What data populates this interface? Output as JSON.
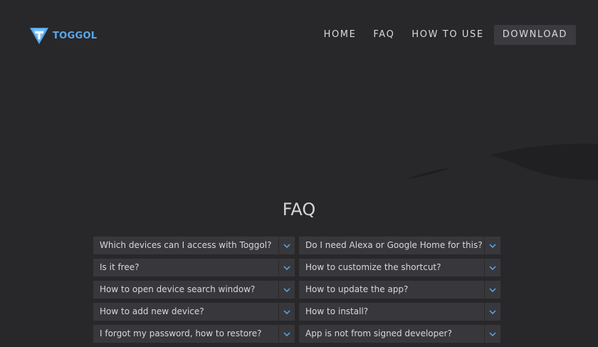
{
  "brand": {
    "name": "TOGGOL",
    "logo_color": "#5aa8ea"
  },
  "nav": {
    "items": [
      {
        "label": "HOME"
      },
      {
        "label": "FAQ"
      },
      {
        "label": "HOW TO USE"
      },
      {
        "label": "DOWNLOAD"
      }
    ]
  },
  "faq": {
    "title": "FAQ",
    "left": [
      {
        "question": "Which devices can I access with Toggol?",
        "icon": "chevron-down-icon"
      },
      {
        "question": "Is it free?",
        "icon": "chevron-down-icon"
      },
      {
        "question": "How to open device search window?",
        "icon": "chevron-down-icon"
      },
      {
        "question": "How to add new device?",
        "icon": "chevron-down-icon"
      },
      {
        "question": "I forgot my password, how to restore?",
        "icon": "chevron-down-icon"
      }
    ],
    "right": [
      {
        "question": "Do I need Alexa or Google Home for this?",
        "icon": "chevron-down-icon"
      },
      {
        "question": "How to customize the shortcut?",
        "icon": "chevron-down-icon"
      },
      {
        "question": "How to update the app?",
        "icon": "chevron-down-icon"
      },
      {
        "question": "How to install?",
        "icon": "chevron-down-icon"
      },
      {
        "question": "App is not from signed developer?",
        "icon": "chevron-down-icon"
      }
    ]
  },
  "colors": {
    "background": "#28282b",
    "item_background": "#38383c",
    "accent": "#5aa8ea"
  }
}
